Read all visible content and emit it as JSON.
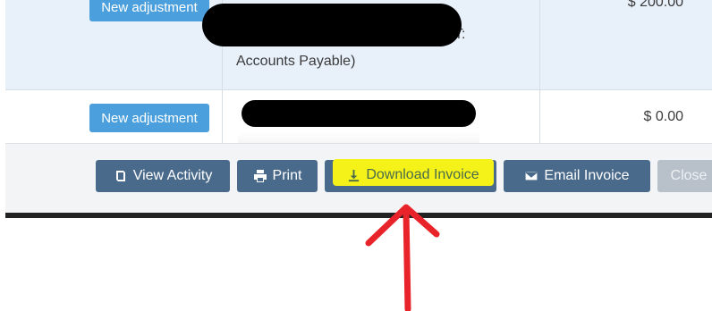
{
  "table": {
    "rows": [
      {
        "button_label": "New adjustment",
        "description": "Accounts Payable)",
        "description_fragment": "T:",
        "amount": "$ 200.00"
      },
      {
        "button_label": "New adjustment",
        "description": "",
        "amount": "$ 0.00"
      }
    ]
  },
  "footer": {
    "buttons": [
      {
        "label": "View Activity",
        "icon": "book-icon"
      },
      {
        "label": "Print",
        "icon": "printer-icon"
      },
      {
        "label": "Download Invoice",
        "icon": "download-icon"
      },
      {
        "label": "Email Invoice",
        "icon": "envelope-icon"
      },
      {
        "label": "Close",
        "icon": ""
      }
    ]
  },
  "colors": {
    "button_blue": "#4a9fdc",
    "footer_button": "#4a6a8b",
    "highlight": "#f5f21a",
    "annotation_arrow": "#e8242a"
  }
}
